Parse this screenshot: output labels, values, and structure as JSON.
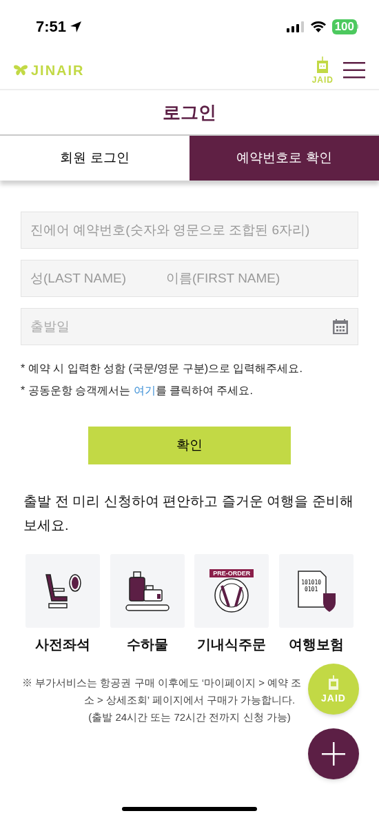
{
  "status_bar": {
    "time": "7:51",
    "battery": "100"
  },
  "header": {
    "logo": "JINAIR",
    "assistant_label": "JAID"
  },
  "title": "로그인",
  "tabs": [
    {
      "label": "회원 로그인",
      "selected": false
    },
    {
      "label": "예약번호로 확인",
      "selected": true
    }
  ],
  "fields": [
    {
      "kind": "text",
      "placeholder": "진에어 예약번호(숫자와 영문으로 조합된 6자리)"
    },
    {
      "kind": "name",
      "placeholder": "성(LAST NAME)",
      "placeholder_2": "이름(FIRST NAME)"
    },
    {
      "kind": "date",
      "placeholder": "출발일"
    }
  ],
  "notes": [
    {
      "text": "* 예약 시 입력한 성함 (국문/영문 구분)으로 입력해주세요."
    },
    {
      "text": "* 공동운항 승객께서는 ",
      "link": "여기",
      "after": "를 클릭하여 주세요."
    }
  ],
  "confirm_button": "확인",
  "promo_heading": "출발 전 미리 신청하여 편안하고 즐거운 여행을 준비해보세요.",
  "services": [
    {
      "kind": "seat",
      "label": "사전좌석"
    },
    {
      "kind": "baggage",
      "label": "수하물"
    },
    {
      "kind": "meal",
      "label": "기내식주문",
      "badge": "PRE-ORDER"
    },
    {
      "kind": "insurance",
      "label": "여행보험",
      "code_lines": [
        "101010",
        "0101"
      ]
    }
  ],
  "notice": [
    "※ 부가서비스는 항공권 구매 이후에도 ‘마이페이지 > 예약 조",
    "소 > 상세조회’ 페이지에서 구매가 가능합니다.",
    "(출발 24시간 또는 72시간 전까지 신청 가능)"
  ],
  "fab_label": "JAID"
}
